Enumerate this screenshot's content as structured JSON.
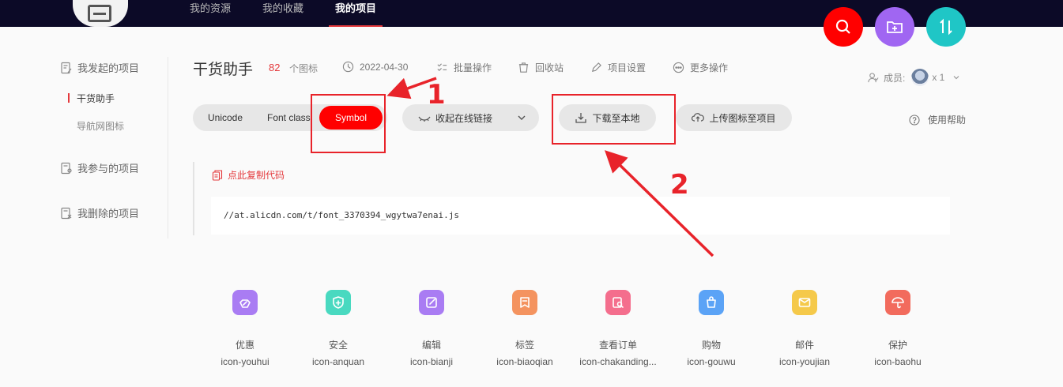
{
  "nav": {
    "items": [
      "我的资源",
      "我的收藏",
      "我的项目"
    ],
    "active_index": 2
  },
  "fabs": [
    {
      "icon": "search-icon",
      "color": "#ff0000"
    },
    {
      "icon": "add-folder-icon",
      "color": "#a066f2"
    },
    {
      "icon": "sort-icon",
      "color": "#1fc6c6"
    }
  ],
  "sidebar": {
    "groups": [
      {
        "label": "我发起的项目",
        "icon": "document-edit-icon"
      },
      {
        "label": "我参与的项目",
        "icon": "document-people-icon"
      },
      {
        "label": "我删除的项目",
        "icon": "document-delete-icon"
      }
    ],
    "sub_items": [
      "干货助手",
      "导航网图标"
    ],
    "active_sub": 0
  },
  "project": {
    "title": "干货助手",
    "count": "82",
    "count_unit": "个图标",
    "date": "2022-04-30",
    "actions": [
      "批量操作",
      "回收站",
      "项目设置",
      "更多操作"
    ],
    "members_label": "成员:",
    "members_count": "x 1"
  },
  "tabs": {
    "items": [
      "Unicode",
      "Font class",
      "Symbol"
    ],
    "active": "Symbol"
  },
  "buttons": {
    "collapse_link": "收起在线链接",
    "download": "下载至本地",
    "upload": "上传图标至项目",
    "help": "使用帮助"
  },
  "code": {
    "copy_label": "点此复制代码",
    "url": "//at.alicdn.com/t/font_3370394_wgytwa7enai.js"
  },
  "icons": [
    {
      "name": "优惠",
      "code": "icon-youhui",
      "color": "#a97cf3"
    },
    {
      "name": "安全",
      "code": "icon-anquan",
      "color": "#49d9c0"
    },
    {
      "name": "编辑",
      "code": "icon-bianji",
      "color": "#a97cf3"
    },
    {
      "name": "标签",
      "code": "icon-biaoqian",
      "color": "#f4935f"
    },
    {
      "name": "查看订单",
      "code": "icon-chakanding...",
      "color": "#f46e8d"
    },
    {
      "name": "购物",
      "code": "icon-gouwu",
      "color": "#5ba3f6"
    },
    {
      "name": "邮件",
      "code": "icon-youjian",
      "color": "#f5c94a"
    },
    {
      "name": "保护",
      "code": "icon-baohu",
      "color": "#f26b5d"
    }
  ],
  "annotations": {
    "labels": [
      "1",
      "2"
    ],
    "color": "#e8232a"
  }
}
